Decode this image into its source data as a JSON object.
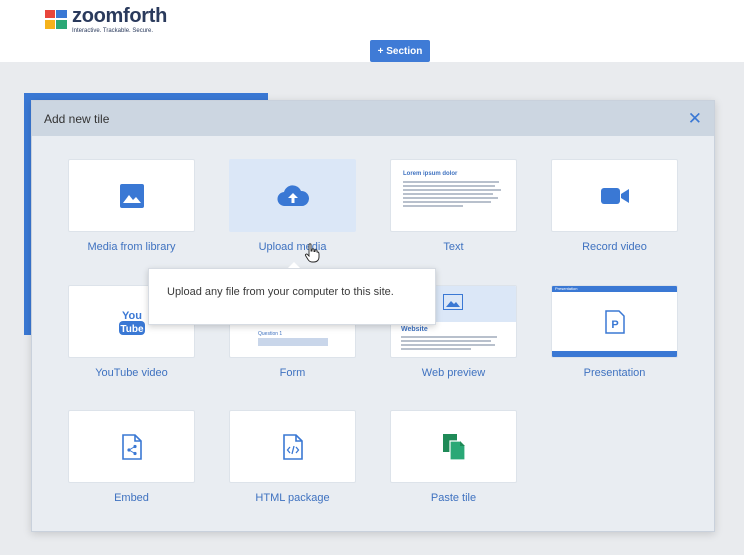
{
  "brand": {
    "name": "zoomforth",
    "tagline": "Interactive. Trackable. Secure.",
    "colors": [
      "#e8453c",
      "#f5b21b",
      "#3a78d4",
      "#2aa876"
    ]
  },
  "toolbar": {
    "section_label": "+ Section"
  },
  "modal": {
    "title": "Add new tile",
    "close_icon": "close-icon"
  },
  "tiles": [
    {
      "label": "Media from library",
      "icon": "image-icon"
    },
    {
      "label": "Upload media",
      "icon": "cloud-upload-icon"
    },
    {
      "label": "Text",
      "icon": "text-preview",
      "preview_heading": "Lorem ipsum dolor"
    },
    {
      "label": "Record video",
      "icon": "video-camera-icon"
    },
    {
      "label": "YouTube video",
      "icon": "youtube-icon",
      "icon_text_top": "You",
      "icon_text_bottom": "Tube"
    },
    {
      "label": "Form",
      "icon": "form-preview",
      "preview_heading": "Question 1"
    },
    {
      "label": "Web preview",
      "icon": "web-preview",
      "preview_heading": "Website"
    },
    {
      "label": "Presentation",
      "icon": "presentation-icon",
      "preview_heading": "Presentation"
    },
    {
      "label": "Embed",
      "icon": "embed-icon"
    },
    {
      "label": "HTML package",
      "icon": "html-package-icon"
    },
    {
      "label": "Paste tile",
      "icon": "paste-icon"
    }
  ],
  "tooltip": {
    "text": "Upload any file from your computer to this site."
  },
  "accent": "#3a78d4"
}
